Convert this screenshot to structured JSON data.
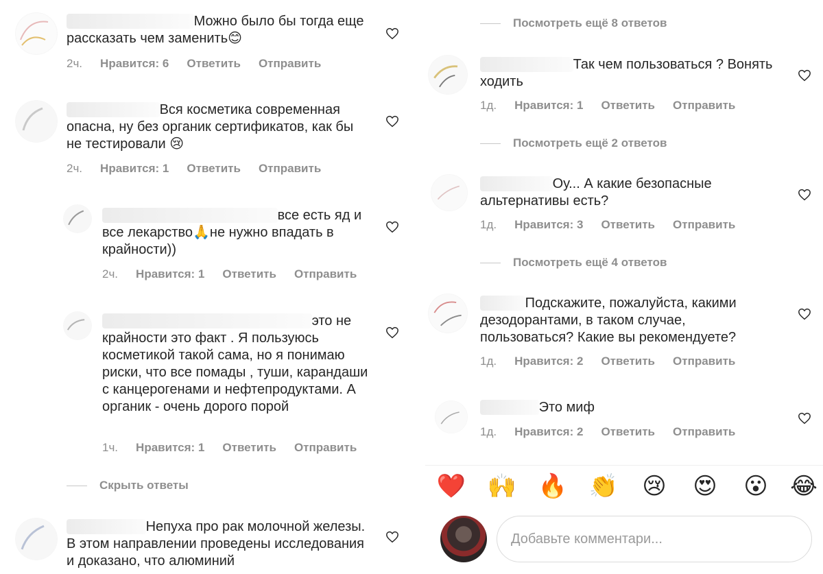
{
  "labels": {
    "likes_prefix": "Нравится:",
    "reply": "Ответить",
    "send": "Отправить"
  },
  "left": {
    "comments": [
      {
        "text": "Можно было бы тогда еще рассказать чем заменить😊",
        "time": "2ч.",
        "likes": "Нравится: 6"
      },
      {
        "text": "Вся косметика современная опасна, ну без органик сертификатов, как бы не тестировали 😢",
        "time": "2ч.",
        "likes": "Нравится: 1"
      },
      {
        "text": "все есть яд и  все лекарство🙏не нужно впадать в крайности))",
        "time": "2ч.",
        "likes": "Нравится: 1"
      },
      {
        "text": "это не крайности это факт . Я пользуюсь косметикой такой сама, но я понимаю риски, что все помады , туши, карандаши с канцерогенами и нефтепродуктами. А органик - очень дорого порой",
        "time": "1ч.",
        "likes": "Нравится: 1"
      },
      {
        "text": "Непуха про рак молочной железы. В этом направлении проведены исследования и доказано, что алюминий"
      }
    ],
    "hide_replies": "Скрыть ответы"
  },
  "right": {
    "threads": [
      "Посмотреть ещё 8 ответов",
      "Посмотреть ещё 2 ответов",
      "Посмотреть ещё 4 ответов"
    ],
    "comments": [
      {
        "text": "Так чем пользоваться ? Вонять ходить",
        "time": "1д.",
        "likes": "Нравится: 1"
      },
      {
        "text": "Оу... А какие безопасные альтернативы есть?",
        "time": "1д.",
        "likes": "Нравится: 3"
      },
      {
        "text": "Подскажите, пожалуйста, какими дезодорантами, в таком случае, пользоваться? Какие вы рекомендуете?",
        "time": "1д.",
        "likes": "Нравится: 2"
      },
      {
        "text": "Это миф",
        "time": "1д.",
        "likes": "Нравится: 2"
      }
    ],
    "emoji_reactions": [
      "❤️",
      "🙌",
      "🔥",
      "👏",
      "😢",
      "😍",
      "😮",
      "😂"
    ],
    "comment_input": {
      "placeholder": "Добавьте комментари..."
    }
  },
  "colors": {
    "text": "#262626",
    "muted": "#8e8e8e",
    "border": "#dbdbdb"
  },
  "icons": [
    "heart-outline-icon",
    "avatar-image"
  ]
}
